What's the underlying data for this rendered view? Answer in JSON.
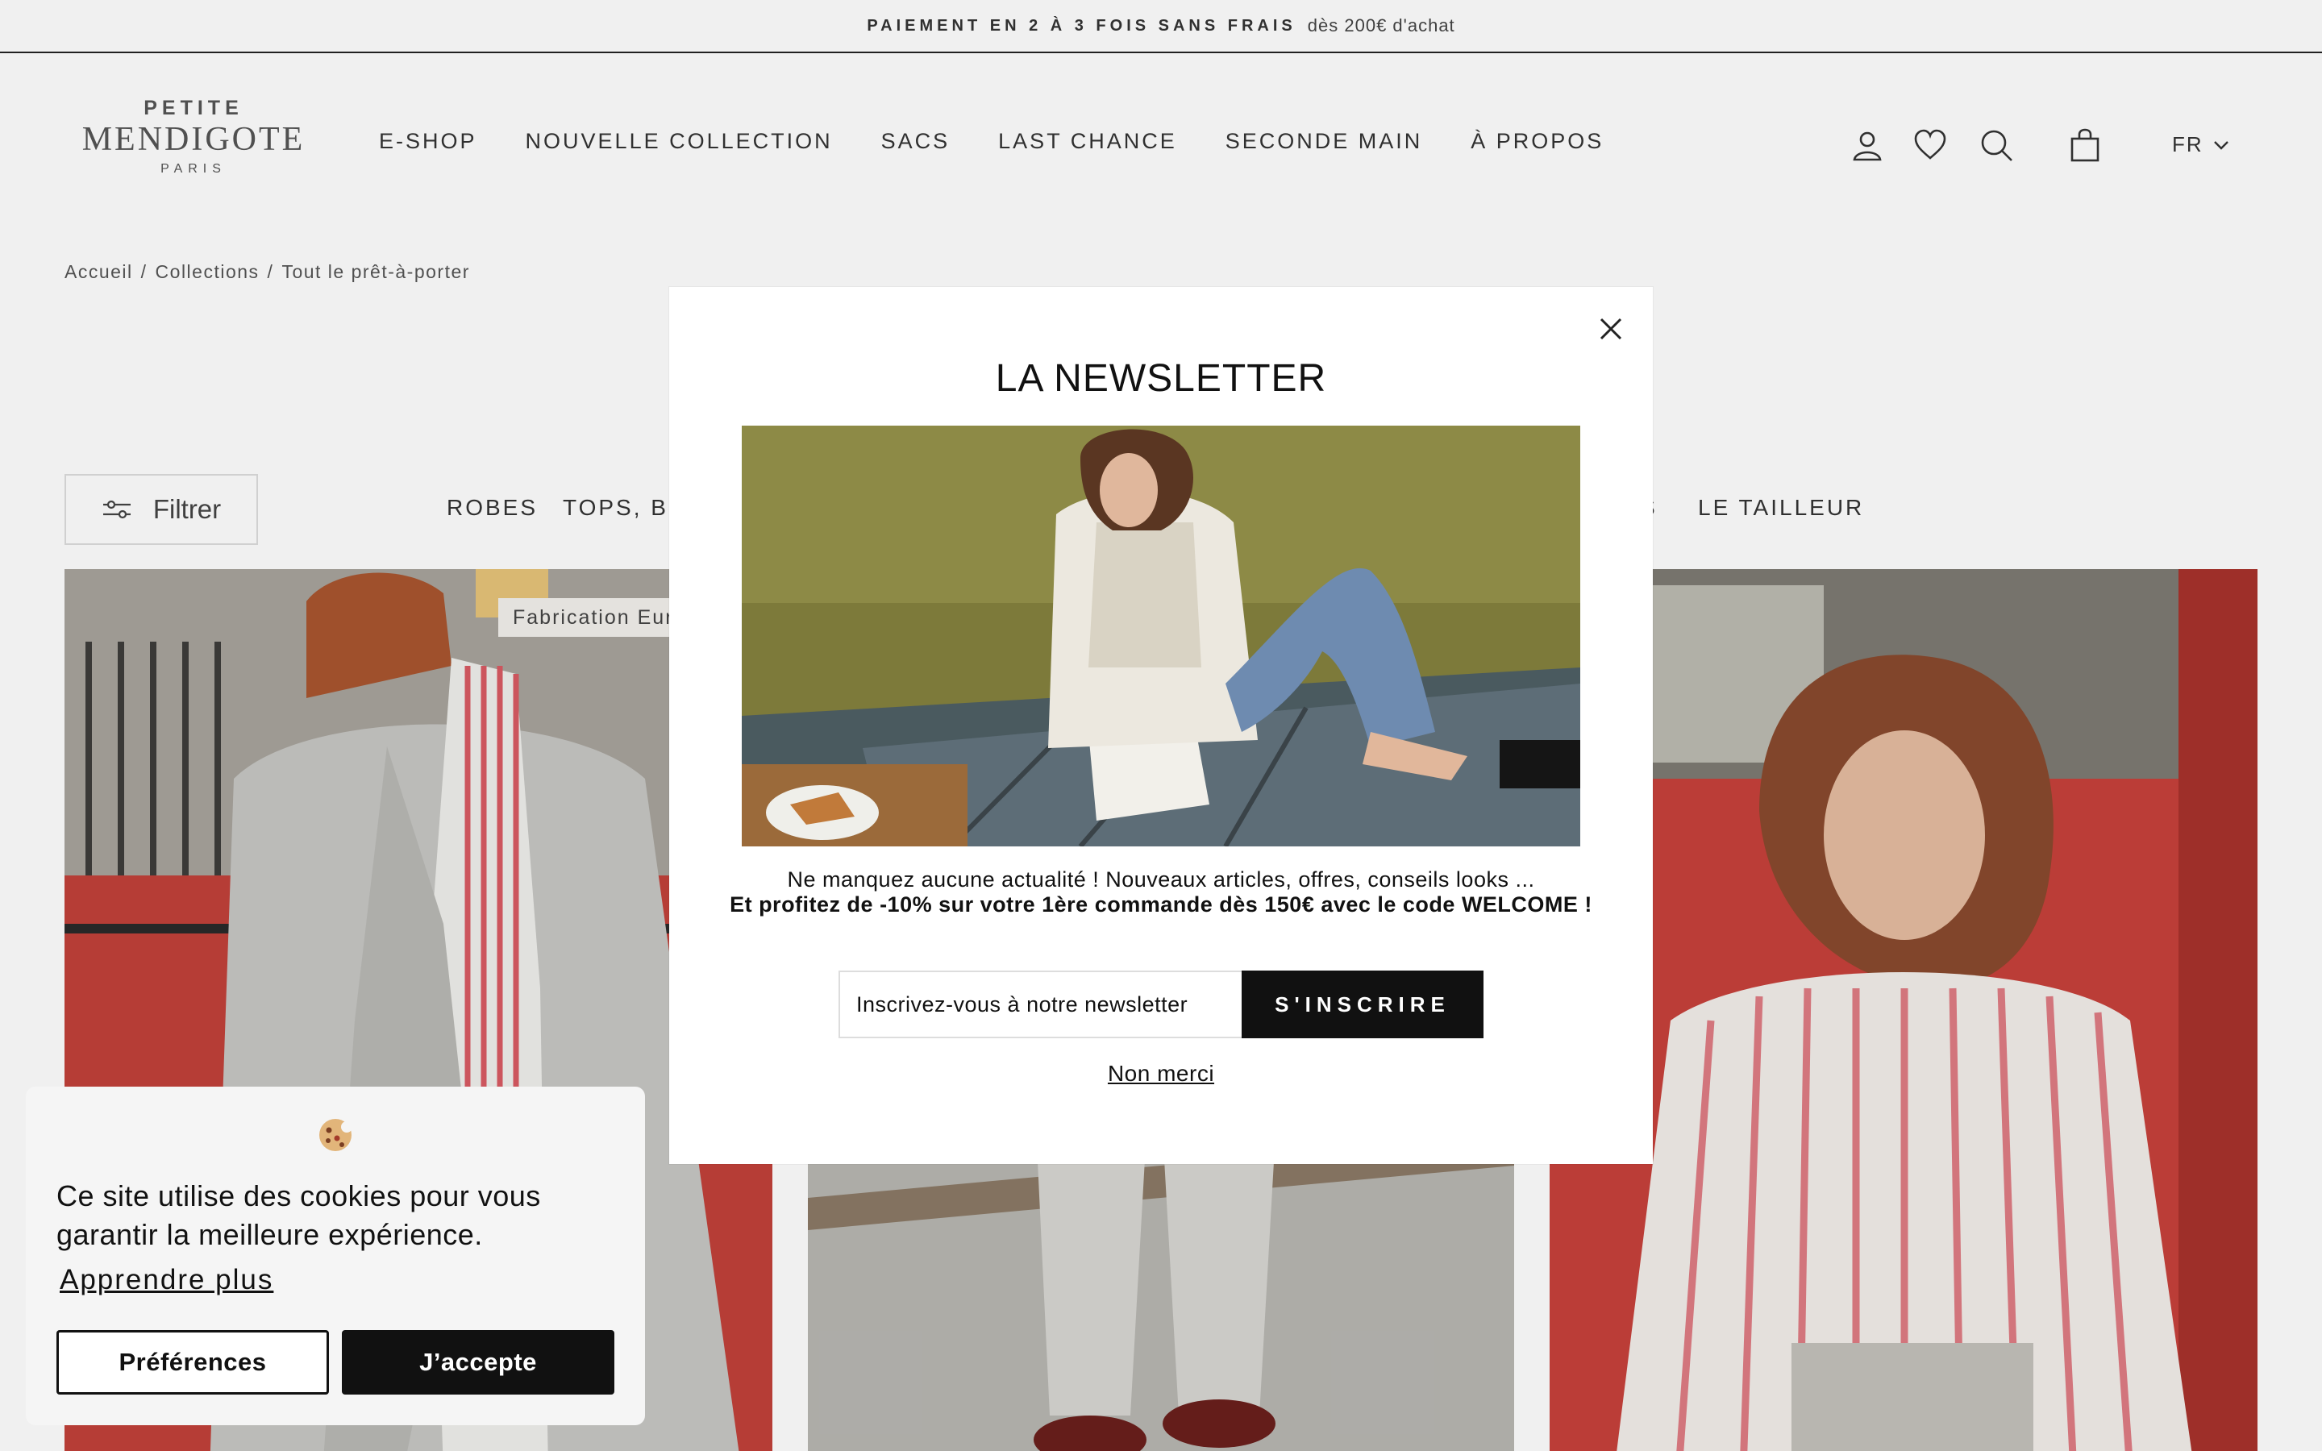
{
  "announcement": {
    "strong": "PAIEMENT EN 2 À 3 FOIS SANS FRAIS",
    "light": "dès 200€ d'achat"
  },
  "logo": {
    "top": "PETITE",
    "main": "MENDIGOTE",
    "sub": "PARIS"
  },
  "nav": {
    "items": [
      "E-SHOP",
      "NOUVELLE COLLECTION",
      "SACS",
      "LAST CHANCE",
      "SECONDE MAIN",
      "À PROPOS"
    ]
  },
  "header_icons": {
    "account": "user-icon",
    "wishlist": "heart-icon",
    "search": "search-icon",
    "cart": "bag-icon",
    "language": "FR"
  },
  "breadcrumb": {
    "items": [
      "Accueil",
      "Collections",
      "Tout le prêt-à-porter"
    ],
    "separator": "/"
  },
  "filter": {
    "label": "Filtrer",
    "icon": "sliders-icon"
  },
  "categories": {
    "items": [
      "ROBES",
      "TOPS, BL",
      "S",
      "LE TAILLEUR"
    ]
  },
  "products": {
    "badge": "Fabrication Eur"
  },
  "newsletter": {
    "title": "LA NEWSLETTER",
    "text_line1": "Ne manquez aucune actualité ! Nouveaux articles, offres, conseils looks ...",
    "text_line2": "Et profitez de -10% sur votre 1ère commande dès 150€ avec le code WELCOME !",
    "input_placeholder": "Inscrivez-vous à notre newsletter",
    "submit_label": "S'INSCRIRE",
    "dismiss_label": "Non merci",
    "close_icon": "close-icon"
  },
  "cookie_banner": {
    "icon": "cookie-icon",
    "text": "Ce site utilise des cookies pour vous garantir la meilleure expérience.",
    "learn_more": "Apprendre plus",
    "preferences_label": "Préférences",
    "accept_label": "J’accepte"
  },
  "colors": {
    "accent": "#111111",
    "announcement_bg": "#ffffff",
    "overlay": "rgba(0,0,0,0.06)"
  }
}
